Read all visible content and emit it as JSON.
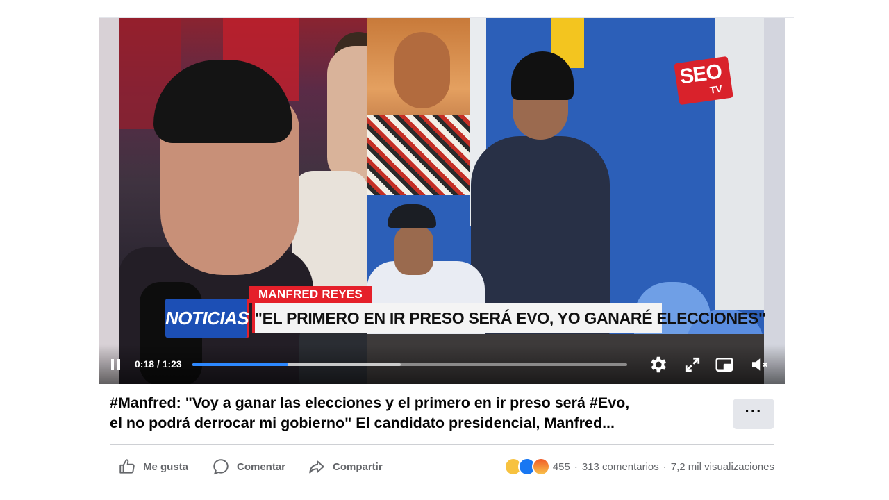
{
  "video": {
    "logo_text": "SEO",
    "logo_sub": "TV",
    "lower_third": {
      "name": "MANFRED REYES",
      "brand": "NOTICIAS",
      "quote": "\"EL PRIMERO EN IR PRESO SERÁ EVO, YO GANARÉ ELECCIONES\""
    },
    "player": {
      "time": "0:18 / 1:23",
      "progress": 0.22,
      "buffered": 0.48,
      "icons": [
        "pause-icon",
        "settings-icon",
        "fullscreen-icon",
        "picture-in-picture-icon",
        "volume-muted-icon"
      ]
    }
  },
  "post": {
    "caption_line1": "#Manfred: \"Voy a ganar las elecciones y el primero en ir preso será #Evo,",
    "caption_line2": "el no podrá derrocar mi gobierno\" El candidato presidencial, Manfred...",
    "more_label": "···"
  },
  "actions": {
    "like": "Me gusta",
    "comment": "Comentar",
    "share": "Compartir"
  },
  "stats": {
    "reactions": [
      "haha",
      "like",
      "angry"
    ],
    "reaction_count": "455",
    "comments": "313 comentarios",
    "separator": "·",
    "views": "7,2 mil visualizaciones"
  },
  "colors": {
    "accent": "#2d88ff",
    "brand_red": "#e5202a",
    "brand_blue": "#1c4fb5",
    "muted_text": "#65676b"
  }
}
